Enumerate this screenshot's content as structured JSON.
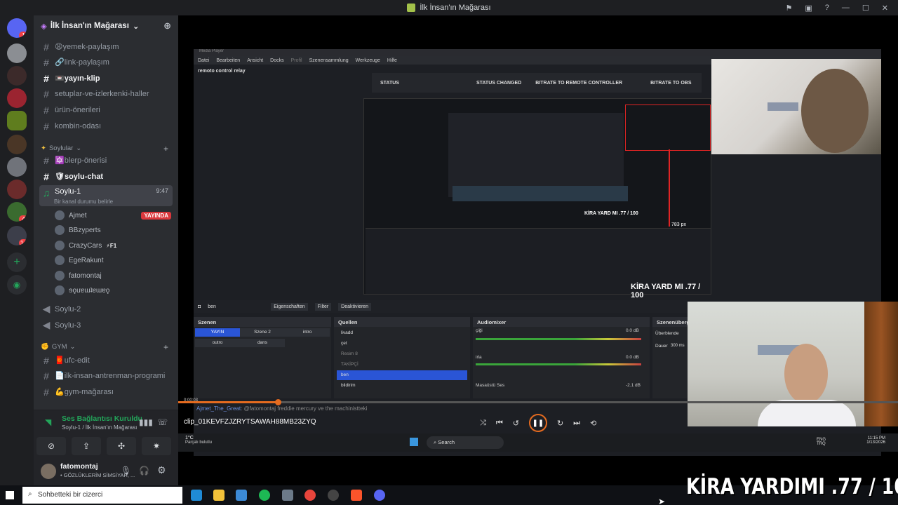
{
  "window": {
    "title": "İlk İnsan'ın Mağarası"
  },
  "server": {
    "name": "İlk İnsan'ın Mağarası",
    "rail_badges": [
      "1",
      "4",
      "14"
    ]
  },
  "channels": [
    {
      "name": "😩yemek-paylaşım",
      "icon": "#"
    },
    {
      "name": "🔗link-paylaşım",
      "icon": "#"
    },
    {
      "name": "📼yayın-klip",
      "icon": "#",
      "bright": true
    },
    {
      "name": "setuplar-ve-izlerkenki-haller",
      "icon": "#"
    },
    {
      "name": "ürün-önerileri",
      "icon": "#"
    },
    {
      "name": "kombin-odası",
      "icon": "#"
    }
  ],
  "category_soylular": "Soylular",
  "soylular_channels": [
    {
      "name": "🔯blerp-önerisi",
      "icon": "#"
    },
    {
      "name": "🛡soylu-chat",
      "icon": "#",
      "bright": true
    }
  ],
  "voice_active": {
    "name": "Soylu-1",
    "time": "9:47",
    "status": "Bir kanal durumu belirle"
  },
  "voice_users": [
    {
      "name": "Ajmet",
      "badge": "YAYINDA"
    },
    {
      "name": "BBzyperts"
    },
    {
      "name": "CrazyCars",
      "badge": "⚡F1"
    },
    {
      "name": "EgeRakunt"
    },
    {
      "name": "fatomontaj"
    },
    {
      "name": "ɘǫuɐɯʇɐɯɐǫ"
    }
  ],
  "voice_channels_more": [
    {
      "name": "Soylu-2"
    },
    {
      "name": "Soylu-3"
    }
  ],
  "category_gym": "GYM",
  "gym_channels": [
    {
      "name": "🧧ufc-edit"
    },
    {
      "name": "📄ilk-insan-antrenman-programi"
    },
    {
      "name": "💪gym-mağarası"
    }
  ],
  "voice_panel": {
    "connected": "Ses Bağlantısı Kuruldu",
    "location": "Soylu-1 / İlk İnsan'ın Mağarası"
  },
  "user_panel": {
    "name": "fatomontaj",
    "status": "• GÖZLÜKLERİM SİMSİYAH, ..."
  },
  "obs": {
    "window_title": "Media Player",
    "menu": [
      "Datei",
      "Bearbeiten",
      "Ansicht",
      "Docks",
      "Profil",
      "Szenensammlung",
      "Werkzeuge",
      "Hilfe"
    ],
    "relay": "remoto control relay",
    "status_cols": [
      "STATUS",
      "STATUS CHANGED",
      "BITRATE TO REMOTE CONTROLLER",
      "BITRATE TO OBS"
    ],
    "source_bar": {
      "name": "ben",
      "props": "Eigenschaften",
      "filter": "Filter",
      "deactivate": "Deaktivieren"
    },
    "docks": {
      "scenes_title": "Szenen",
      "scenes": [
        "YAYIN",
        "Szene 2",
        "intro",
        "outro",
        "dans"
      ],
      "sources_title": "Quellen",
      "sources": [
        "livadd",
        "çet",
        "Resim 8",
        "TAKİPÇİ",
        "ben",
        "bildirim"
      ],
      "mixer_title": "Audiomixer",
      "mixer": [
        {
          "name": "çiği",
          "db": "0.0 dB"
        },
        {
          "name": "irla",
          "db": "0.0 dB"
        },
        {
          "name": "Masaüstü Ses",
          "db": "-2.1 dB"
        }
      ],
      "transitions_title": "Szenenüberg",
      "transition": "Überblende",
      "duration_label": "Dauer",
      "duration": "300 ms"
    },
    "nested_overlay": "KİRA YARD MI .77 / 100",
    "px_label": "783 px"
  },
  "player": {
    "time": "0:00:03",
    "clip": "clip_01KEVFZJZRYTSAWAH88MB23ZYQ",
    "chat_user": "Ajmet_The_Great",
    "chat_text": ": @fatomontaj freddie mercury ve the machinistteki"
  },
  "inner_taskbar": {
    "weather": "1°C",
    "weather_sub": "Parçalı bulutlu",
    "search": "Search",
    "lang": "ENG TRQ",
    "time": "11:15 PM",
    "date": "1/13/2026"
  },
  "host_taskbar": {
    "search": "Sohbetteki bir cizerci"
  },
  "overlay_text": "KİRA YARDIMI .77 / 100",
  "colors": {
    "discord_bg": "#2b2d31",
    "live_red": "#da373c",
    "connected_green": "#23a55a",
    "obs_blue": "#2a55d6",
    "accent_orange": "#e56b1f"
  }
}
